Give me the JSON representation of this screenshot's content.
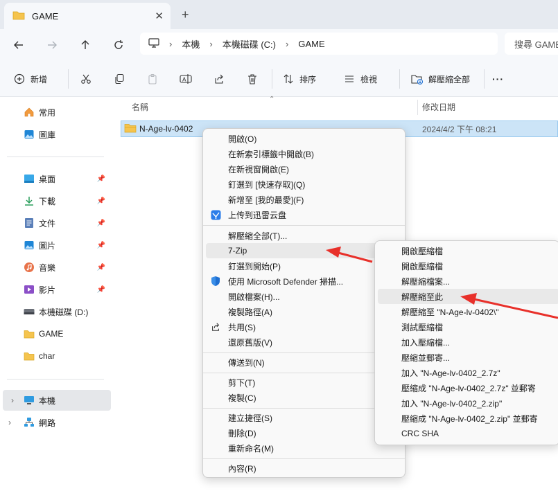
{
  "tab": {
    "title": "GAME"
  },
  "nav": {
    "breadcrumbs": [
      "本機",
      "本機磁碟 (C:)",
      "GAME"
    ],
    "search_placeholder": "搜尋 GAME"
  },
  "toolbar": {
    "new_label": "新增",
    "sort_label": "排序",
    "view_label": "檢視",
    "extract_all_label": "解壓縮全部",
    "more_label": "···"
  },
  "sidebar": {
    "quick": [
      {
        "label": "常用",
        "icon": "home-icon"
      },
      {
        "label": "圖庫",
        "icon": "gallery-icon"
      }
    ],
    "pinned": [
      {
        "label": "桌面",
        "icon": "desktop-icon"
      },
      {
        "label": "下載",
        "icon": "download-icon"
      },
      {
        "label": "文件",
        "icon": "document-icon"
      },
      {
        "label": "圖片",
        "icon": "pictures-icon"
      },
      {
        "label": "音樂",
        "icon": "music-icon"
      },
      {
        "label": "影片",
        "icon": "video-icon"
      }
    ],
    "drives": [
      {
        "label": "本機磁碟 (D:)",
        "icon": "drive-icon"
      },
      {
        "label": "GAME",
        "icon": "folder-icon"
      },
      {
        "label": "char",
        "icon": "folder-icon"
      }
    ],
    "bottom": [
      {
        "label": "本機",
        "icon": "this-pc-icon"
      },
      {
        "label": "網路",
        "icon": "network-icon"
      }
    ]
  },
  "columns": {
    "name": "名稱",
    "modified": "修改日期"
  },
  "file": {
    "name": "N-Age-lv-0402",
    "modified": "2024/4/2 下午 08:21"
  },
  "context_menu": [
    "開啟(O)",
    "在新索引標籤中開啟(B)",
    "在新視窗開啟(E)",
    "釘選到 [快速存取](Q)",
    "新增至 [我的最愛](F)",
    "上传到迅雷云盘",
    "解壓縮全部(T)...",
    "7-Zip",
    "釘選到開始(P)",
    "使用 Microsoft Defender 掃描...",
    "開啟檔案(H)...",
    "複製路徑(A)",
    "共用(S)",
    "還原舊版(V)",
    "傳送到(N)",
    "剪下(T)",
    "複製(C)",
    "建立捷徑(S)",
    "刪除(D)",
    "重新命名(M)",
    "內容(R)"
  ],
  "submenu_7zip": [
    "開啟壓縮檔",
    "開啟壓縮檔",
    "解壓縮檔案...",
    "解壓縮至此",
    "解壓縮至 \"N-Age-lv-0402\\\"",
    "測試壓縮檔",
    "加入壓縮檔...",
    "壓縮並郵寄...",
    "加入 \"N-Age-lv-0402_2.7z\"",
    "壓縮成 \"N-Age-lv-0402_2.7z\" 並郵寄",
    "加入 \"N-Age-lv-0402_2.zip\"",
    "壓縮成 \"N-Age-lv-0402_2.zip\" 並郵寄",
    "CRC SHA"
  ],
  "colors": {
    "selection": "#cce4f7",
    "selection_border": "#99c9ef",
    "annotation_arrow": "#e8302a",
    "folder": "#f5c44e",
    "defender": "#1f6fd1"
  }
}
